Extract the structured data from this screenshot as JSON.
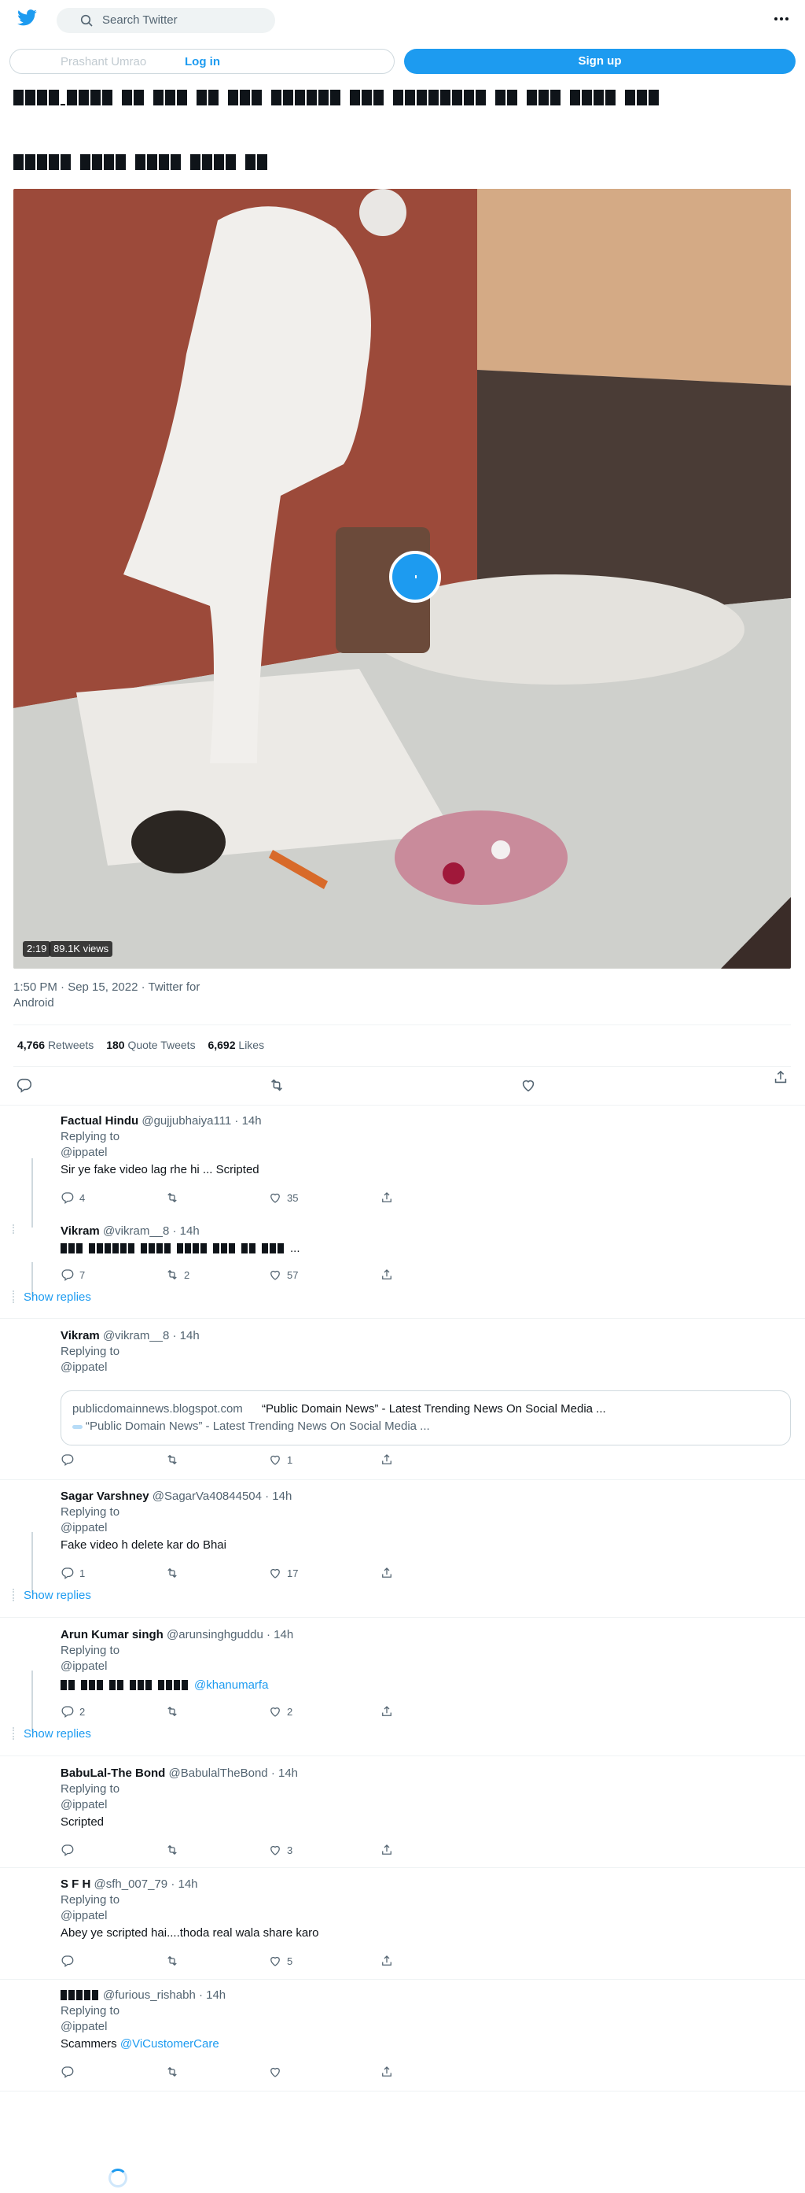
{
  "header": {
    "search_placeholder": "Search Twitter",
    "ghost_user": "Prashant Umrao",
    "login_label": "Log in",
    "signup_label": "Sign up"
  },
  "colors": {
    "accent": "#1d9bf0",
    "text": "#0f1419",
    "muted": "#536471",
    "border": "#cfd9de"
  },
  "tweet": {
    "video_duration": "2:19",
    "video_views": "89.1K views",
    "timestamp": "1:50 PM · Sep 15, 2022 · Twitter for Android",
    "retweets_count": "4,766",
    "retweets_label": "Retweets",
    "quotes_count": "180",
    "quotes_label": "Quote Tweets",
    "likes_count": "6,692",
    "likes_label": "Likes"
  },
  "replies": [
    {
      "name": "Factual Hindu",
      "handle": "@gujjubhaiya111 · 14h",
      "replying": "Replying to",
      "to": "@ippatel",
      "text": "Sir ye fake video lag rhe hi ... Scripted",
      "replies": "4",
      "retweets": "",
      "likes": "35"
    },
    {
      "name": "Vikram",
      "handle": "@vikram__8 · 14h",
      "text_suffix": "...",
      "replies": "7",
      "retweets": "2",
      "likes": "57",
      "show_replies": "Show replies"
    },
    {
      "name": "Vikram",
      "handle": "@vikram__8 · 14h",
      "replying": "Replying to",
      "to": "@ippatel",
      "card_site": "publicdomainnews.blogspot.com",
      "card_title": "“Public Domain News” - Latest Trending News On Social Media ...",
      "card_desc": "“Public Domain News” - Latest Trending News On Social Media ...",
      "replies": "",
      "retweets": "",
      "likes": "1"
    },
    {
      "name": "Sagar Varshney",
      "handle": "@SagarVa40844504 · 14h",
      "replying": "Replying to",
      "to": "@ippatel",
      "text": "Fake video h delete kar do Bhai",
      "replies": "1",
      "retweets": "",
      "likes": "17",
      "show_replies": "Show replies"
    },
    {
      "name": "Arun Kumar singh",
      "handle": "@arunsinghguddu · 14h",
      "replying": "Replying to",
      "to": "@ippatel",
      "mention": "@khanumarfa",
      "replies": "2",
      "retweets": "",
      "likes": "2",
      "show_replies": "Show replies"
    },
    {
      "name": "BabuLal-The Bond",
      "handle": "@BabulalTheBond · 14h",
      "replying": "Replying to",
      "to": "@ippatel",
      "text": "Scripted",
      "replies": "",
      "retweets": "",
      "likes": "3"
    },
    {
      "name": "S F H",
      "handle": "@sfh_007_79 · 14h",
      "replying": "Replying to",
      "to": "@ippatel",
      "text": "Abey ye scripted hai....thoda real wala share karo",
      "replies": "",
      "retweets": "",
      "likes": "5"
    },
    {
      "handle": "@furious_rishabh · 14h",
      "replying": "Replying to",
      "to": "@ippatel",
      "text": "Scammers",
      "mention": "@ViCustomerCare",
      "replies": "",
      "retweets": "",
      "likes": ""
    }
  ]
}
